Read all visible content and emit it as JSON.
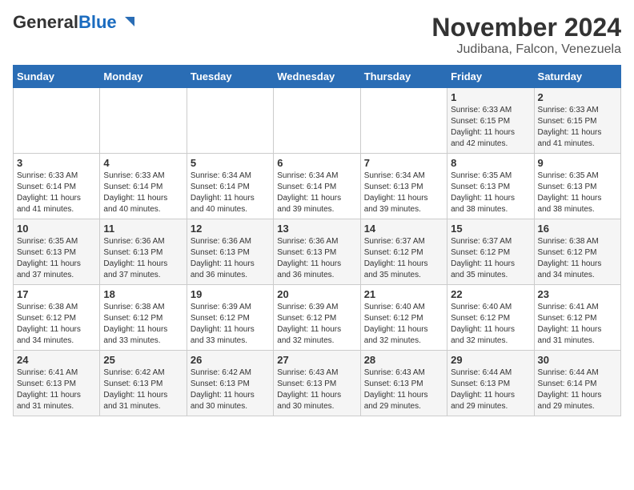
{
  "header": {
    "logo_line1": "General",
    "logo_line2": "Blue",
    "title": "November 2024",
    "subtitle": "Judibana, Falcon, Venezuela"
  },
  "calendar": {
    "days_of_week": [
      "Sunday",
      "Monday",
      "Tuesday",
      "Wednesday",
      "Thursday",
      "Friday",
      "Saturday"
    ],
    "weeks": [
      [
        {
          "day": "",
          "info": ""
        },
        {
          "day": "",
          "info": ""
        },
        {
          "day": "",
          "info": ""
        },
        {
          "day": "",
          "info": ""
        },
        {
          "day": "",
          "info": ""
        },
        {
          "day": "1",
          "info": "Sunrise: 6:33 AM\nSunset: 6:15 PM\nDaylight: 11 hours\nand 42 minutes."
        },
        {
          "day": "2",
          "info": "Sunrise: 6:33 AM\nSunset: 6:15 PM\nDaylight: 11 hours\nand 41 minutes."
        }
      ],
      [
        {
          "day": "3",
          "info": "Sunrise: 6:33 AM\nSunset: 6:14 PM\nDaylight: 11 hours\nand 41 minutes."
        },
        {
          "day": "4",
          "info": "Sunrise: 6:33 AM\nSunset: 6:14 PM\nDaylight: 11 hours\nand 40 minutes."
        },
        {
          "day": "5",
          "info": "Sunrise: 6:34 AM\nSunset: 6:14 PM\nDaylight: 11 hours\nand 40 minutes."
        },
        {
          "day": "6",
          "info": "Sunrise: 6:34 AM\nSunset: 6:14 PM\nDaylight: 11 hours\nand 39 minutes."
        },
        {
          "day": "7",
          "info": "Sunrise: 6:34 AM\nSunset: 6:13 PM\nDaylight: 11 hours\nand 39 minutes."
        },
        {
          "day": "8",
          "info": "Sunrise: 6:35 AM\nSunset: 6:13 PM\nDaylight: 11 hours\nand 38 minutes."
        },
        {
          "day": "9",
          "info": "Sunrise: 6:35 AM\nSunset: 6:13 PM\nDaylight: 11 hours\nand 38 minutes."
        }
      ],
      [
        {
          "day": "10",
          "info": "Sunrise: 6:35 AM\nSunset: 6:13 PM\nDaylight: 11 hours\nand 37 minutes."
        },
        {
          "day": "11",
          "info": "Sunrise: 6:36 AM\nSunset: 6:13 PM\nDaylight: 11 hours\nand 37 minutes."
        },
        {
          "day": "12",
          "info": "Sunrise: 6:36 AM\nSunset: 6:13 PM\nDaylight: 11 hours\nand 36 minutes."
        },
        {
          "day": "13",
          "info": "Sunrise: 6:36 AM\nSunset: 6:13 PM\nDaylight: 11 hours\nand 36 minutes."
        },
        {
          "day": "14",
          "info": "Sunrise: 6:37 AM\nSunset: 6:12 PM\nDaylight: 11 hours\nand 35 minutes."
        },
        {
          "day": "15",
          "info": "Sunrise: 6:37 AM\nSunset: 6:12 PM\nDaylight: 11 hours\nand 35 minutes."
        },
        {
          "day": "16",
          "info": "Sunrise: 6:38 AM\nSunset: 6:12 PM\nDaylight: 11 hours\nand 34 minutes."
        }
      ],
      [
        {
          "day": "17",
          "info": "Sunrise: 6:38 AM\nSunset: 6:12 PM\nDaylight: 11 hours\nand 34 minutes."
        },
        {
          "day": "18",
          "info": "Sunrise: 6:38 AM\nSunset: 6:12 PM\nDaylight: 11 hours\nand 33 minutes."
        },
        {
          "day": "19",
          "info": "Sunrise: 6:39 AM\nSunset: 6:12 PM\nDaylight: 11 hours\nand 33 minutes."
        },
        {
          "day": "20",
          "info": "Sunrise: 6:39 AM\nSunset: 6:12 PM\nDaylight: 11 hours\nand 32 minutes."
        },
        {
          "day": "21",
          "info": "Sunrise: 6:40 AM\nSunset: 6:12 PM\nDaylight: 11 hours\nand 32 minutes."
        },
        {
          "day": "22",
          "info": "Sunrise: 6:40 AM\nSunset: 6:12 PM\nDaylight: 11 hours\nand 32 minutes."
        },
        {
          "day": "23",
          "info": "Sunrise: 6:41 AM\nSunset: 6:12 PM\nDaylight: 11 hours\nand 31 minutes."
        }
      ],
      [
        {
          "day": "24",
          "info": "Sunrise: 6:41 AM\nSunset: 6:13 PM\nDaylight: 11 hours\nand 31 minutes."
        },
        {
          "day": "25",
          "info": "Sunrise: 6:42 AM\nSunset: 6:13 PM\nDaylight: 11 hours\nand 31 minutes."
        },
        {
          "day": "26",
          "info": "Sunrise: 6:42 AM\nSunset: 6:13 PM\nDaylight: 11 hours\nand 30 minutes."
        },
        {
          "day": "27",
          "info": "Sunrise: 6:43 AM\nSunset: 6:13 PM\nDaylight: 11 hours\nand 30 minutes."
        },
        {
          "day": "28",
          "info": "Sunrise: 6:43 AM\nSunset: 6:13 PM\nDaylight: 11 hours\nand 29 minutes."
        },
        {
          "day": "29",
          "info": "Sunrise: 6:44 AM\nSunset: 6:13 PM\nDaylight: 11 hours\nand 29 minutes."
        },
        {
          "day": "30",
          "info": "Sunrise: 6:44 AM\nSunset: 6:14 PM\nDaylight: 11 hours\nand 29 minutes."
        }
      ]
    ]
  }
}
